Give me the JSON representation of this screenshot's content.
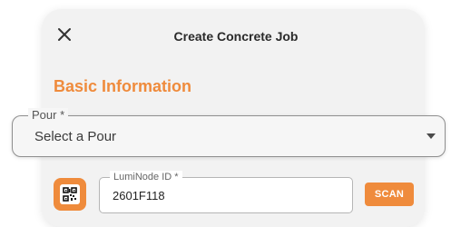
{
  "dialog": {
    "title": "Create Concrete Job",
    "close_icon": "close-icon"
  },
  "section": {
    "heading": "Basic Information"
  },
  "pour": {
    "label": "Pour *",
    "value": "Select a Pour",
    "icon": "chevron-down-icon"
  },
  "lumi": {
    "label": "LumiNode ID *",
    "value": "2601F118",
    "scan_label": "SCAN",
    "qr_icon": "qr-code-icon"
  },
  "colors": {
    "accent": "#ef8b3c",
    "dialog_bg": "#f2f2f2",
    "title_text": "#2a2a2a"
  }
}
